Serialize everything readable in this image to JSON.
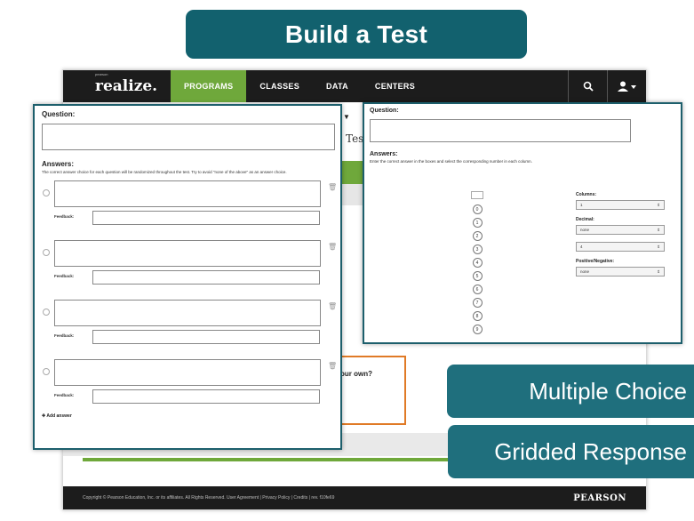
{
  "title": "Build a Test",
  "nav": {
    "logo": "realize.",
    "logo_small": "pearson",
    "items": [
      "PROGRAMS",
      "CLASSES",
      "DATA",
      "CENTERS"
    ],
    "search_icon": "search-icon",
    "user_icon": "user-dropdown-icon"
  },
  "background": {
    "partial_text": "Tes",
    "own_text": "our own?",
    "footer_text": "Copyright © Pearson Education, Inc. or its affiliates. All Rights Reserved. User Agreement | Privacy Policy | Credits | rev. f10fe69",
    "footer_brand": "PEARSON"
  },
  "multiple_choice_panel": {
    "question_label": "Question:",
    "answers_label": "Answers:",
    "instructions": "The correct answer choice for each question will be randomized throughout the test. Try to avoid \"none of the above\" as an answer choice.",
    "feedback_label": "Feedback:",
    "add_answer": "Add answer",
    "answers": [
      {},
      {},
      {},
      {}
    ]
  },
  "gridded_panel": {
    "question_label": "Question:",
    "answers_label": "Answers:",
    "instructions": "Enter the correct answer in the boxes and select the corresponding number in each column.",
    "digits": [
      "0",
      "1",
      "2",
      "3",
      "4",
      "5",
      "6",
      "7",
      "8",
      "9"
    ],
    "columns_label": "Columns:",
    "columns_value": "1",
    "decimal_label": "Decimal:",
    "decimal_value": "none",
    "decimal_value2": "4",
    "posneg_label": "Positive/Negative:",
    "posneg_value": "none"
  },
  "buttons": {
    "multiple_choice": "Multiple Choice",
    "gridded_response": "Gridded Response"
  },
  "colors": {
    "teal": "#12616e",
    "nav_green": "#6fa83b",
    "orange": "#e07a26"
  }
}
